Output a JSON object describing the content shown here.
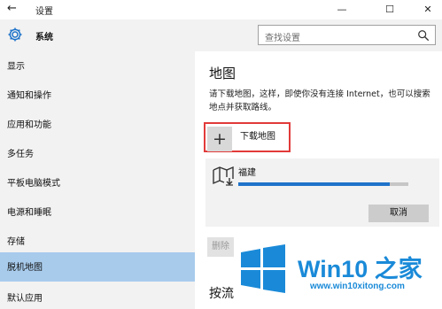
{
  "window": {
    "title": "设置",
    "back_icon": "back-arrow-icon",
    "controls": {
      "minimize": "—",
      "maximize": "☐",
      "close": "✕"
    }
  },
  "header": {
    "section": "系统",
    "gear_icon": "gear-icon",
    "search_placeholder": "查找设置",
    "search_icon": "search-icon"
  },
  "sidebar": {
    "items": [
      {
        "label": "显示",
        "active": false
      },
      {
        "label": "通知和操作",
        "active": false
      },
      {
        "label": "应用和功能",
        "active": false
      },
      {
        "label": "多任务",
        "active": false
      },
      {
        "label": "平板电脑模式",
        "active": false
      },
      {
        "label": "电源和睡眠",
        "active": false
      },
      {
        "label": "存储",
        "active": false
      },
      {
        "label": "脱机地图",
        "active": true
      },
      {
        "label": "默认应用",
        "active": false
      }
    ]
  },
  "main": {
    "heading": "地图",
    "description": "请下载地图，这样，即使你没有连接 Internet，也可以搜索地点并获取路线。",
    "download": {
      "plus": "+",
      "label": "下载地图"
    },
    "map_item": {
      "icon": "map-icon",
      "name": "福建",
      "progress_fraction": 0.89,
      "cancel_label": "取消"
    },
    "delete_label": "删除",
    "next_heading": "按流"
  },
  "watermark": {
    "title": "Win10 之家",
    "url": "www.win10xitong.com",
    "logo_color": "#1a8ad8"
  },
  "colors": {
    "accent": "#1f73c9",
    "selection": "#a8cbec",
    "highlight_border": "#e23a3a",
    "sidebar_bg": "#f2f2f2"
  }
}
